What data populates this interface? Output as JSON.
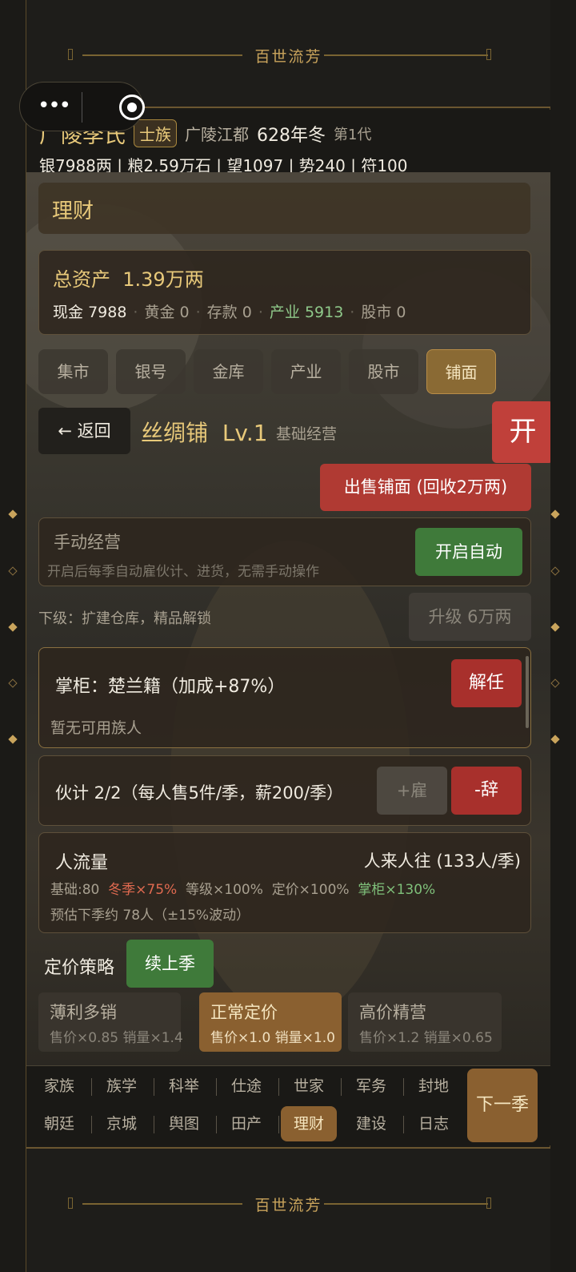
{
  "banner_title": "百世流芳",
  "capsule": {
    "more_icon": "more-dots-icon",
    "close_icon": "target-icon"
  },
  "header": {
    "clan_name": "广陵李氏",
    "rank": "士族",
    "location": "广陵江都",
    "year": "628年冬",
    "generation": "第1代",
    "stats": "银7988两 | 粮2.59万石 | 望1097 | 势240 | 符100"
  },
  "section_title": "理财",
  "assets": {
    "total_label": "总资产",
    "total_value": "1.39万两",
    "cash_label": "现金",
    "cash_value": "7988",
    "gold_label": "黄金",
    "gold_value": "0",
    "deposit_label": "存款",
    "deposit_value": "0",
    "property_label": "产业",
    "property_value": "5913",
    "stock_label": "股市",
    "stock_value": "0"
  },
  "tabs": [
    {
      "label": "集市",
      "active": false
    },
    {
      "label": "银号",
      "active": false
    },
    {
      "label": "金库",
      "active": false
    },
    {
      "label": "产业",
      "active": false
    },
    {
      "label": "股市",
      "active": false
    },
    {
      "label": "铺面",
      "active": true
    }
  ],
  "shop": {
    "back_label": "← 返回",
    "name": "丝绸铺",
    "level": "Lv.1",
    "mode": "基础经营",
    "open_label": "开",
    "sell_label": "出售铺面 (回收2万两)",
    "manual_title": "手动经营",
    "manual_desc": "开启后每季自动雇伙计、进货，无需手动操作",
    "auto_label": "开启自动",
    "next_level": "下级：扩建仓库，精品解锁",
    "upgrade_label": "升级 6万两",
    "manager": "掌柜：楚兰籍（加成+87%）",
    "no_member": "暂无可用族人",
    "fire_label": "解任",
    "staff": "伙计 2/2（每人售5件/季，薪200/季）",
    "hire_label": "+雇",
    "dismiss_label": "-辞",
    "traffic_title": "人流量",
    "traffic_rate": "人来人往 (133人/季)",
    "factor_base": "基础:80",
    "factor_season": "冬季×75%",
    "factor_level": "等级×100%",
    "factor_price": "定价×100%",
    "factor_manager": "掌柜×130%",
    "estimate": "预估下季约 78人（±15%波动）",
    "pricing_label": "定价策略",
    "continue_label": "续上季",
    "pricing": [
      {
        "name": "薄利多销",
        "detail": "售价×0.85 销量×1.4",
        "active": false
      },
      {
        "name": "正常定价",
        "detail": "售价×1.0 销量×1.0",
        "active": true
      },
      {
        "name": "高价精营",
        "detail": "售价×1.2 销量×0.65",
        "active": false
      }
    ]
  },
  "nav": {
    "row1": [
      "家族",
      "族学",
      "科举",
      "仕途",
      "世家",
      "军务",
      "封地"
    ],
    "row2": [
      "朝廷",
      "京城",
      "舆图",
      "田产",
      "理财",
      "建设",
      "日志"
    ],
    "active": "理财",
    "next_label": "下一季"
  },
  "colors": {
    "accent_gold": "#e8c97a",
    "green": "#3f7a3a",
    "red": "#b03a33",
    "active_tab": "#8a6030"
  }
}
